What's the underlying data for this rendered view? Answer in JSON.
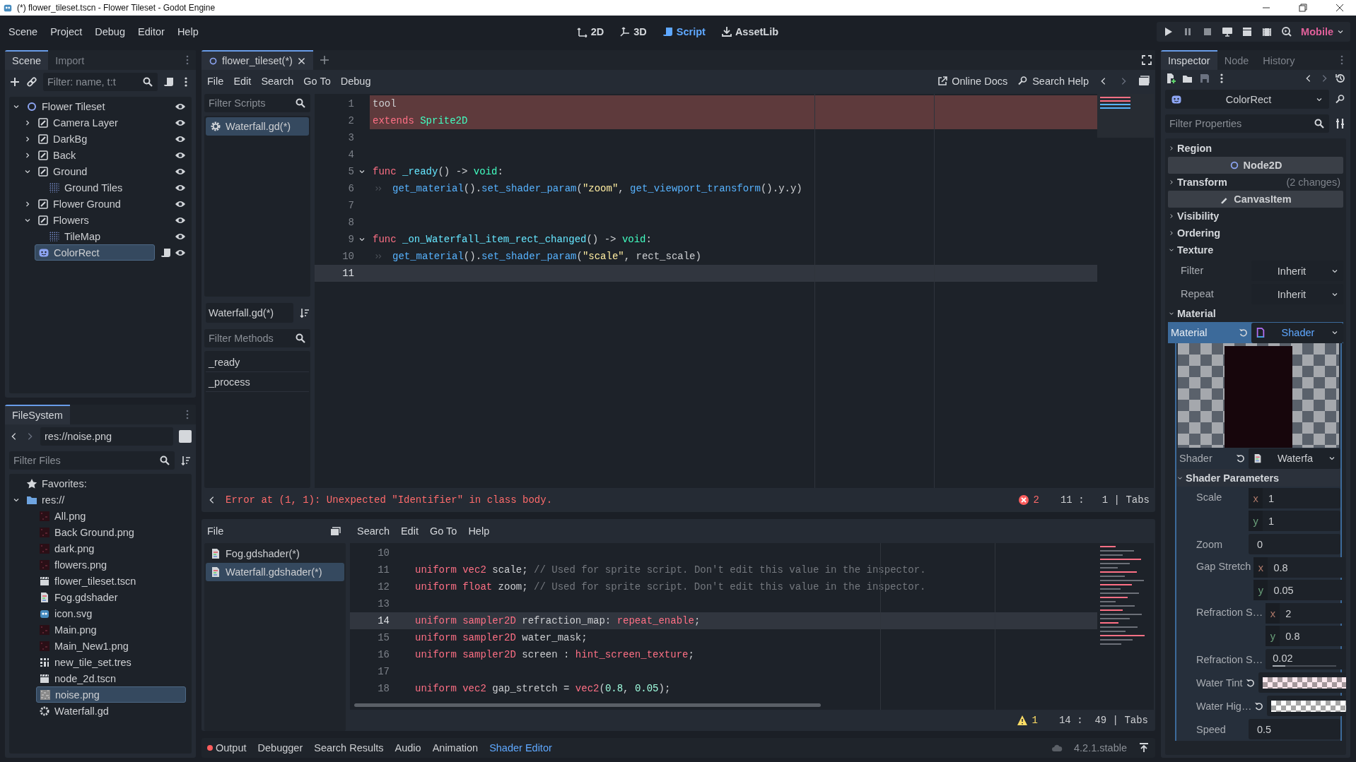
{
  "window": {
    "title": "(*) flower_tileset.tscn - Flower Tileset - Godot Engine"
  },
  "menu_bar": {
    "menus": [
      "Scene",
      "Project",
      "Debug",
      "Editor",
      "Help"
    ],
    "workspaces": [
      {
        "label": "2D",
        "selected": false
      },
      {
        "label": "3D",
        "selected": false
      },
      {
        "label": "Script",
        "selected": true
      },
      {
        "label": "AssetLib",
        "selected": false
      }
    ],
    "renderer": "Mobile"
  },
  "scene_dock": {
    "tabs": [
      {
        "label": "Scene",
        "selected": true
      },
      {
        "label": "Import",
        "selected": false
      }
    ],
    "filter": {
      "placeholder": "Filter: name, t:t"
    },
    "tree": [
      {
        "label": "Flower Tileset",
        "kind": "node2d",
        "expanded": true,
        "selected": false,
        "script": false,
        "visible": true,
        "children": [
          {
            "label": "Camera Layer",
            "kind": "layer",
            "expanded": false,
            "selected": false,
            "script": false,
            "visible": true
          },
          {
            "label": "DarkBg",
            "kind": "layer",
            "expanded": false,
            "selected": false,
            "script": false,
            "visible": true
          },
          {
            "label": "Back",
            "kind": "layer",
            "expanded": false,
            "selected": false,
            "script": false,
            "visible": true
          },
          {
            "label": "Ground",
            "kind": "layer",
            "expanded": true,
            "selected": false,
            "script": false,
            "visible": true,
            "children": [
              {
                "label": "Ground Tiles",
                "kind": "tilemap",
                "selected": false,
                "script": false,
                "visible": true
              }
            ]
          },
          {
            "label": "Flower Ground",
            "kind": "layer",
            "expanded": false,
            "selected": false,
            "script": false,
            "visible": true
          },
          {
            "label": "Flowers",
            "kind": "layer",
            "expanded": true,
            "selected": false,
            "script": false,
            "visible": true,
            "children": [
              {
                "label": "TileMap",
                "kind": "tilemap",
                "selected": false,
                "script": false,
                "visible": true
              }
            ]
          },
          {
            "label": "ColorRect",
            "kind": "control",
            "selected": true,
            "script": true,
            "visible": true
          }
        ]
      }
    ]
  },
  "filesystem_dock": {
    "tabs": [
      {
        "label": "FileSystem",
        "selected": true
      }
    ],
    "path": "res://noise.png",
    "filter": {
      "placeholder": "Filter Files"
    },
    "tree": [
      {
        "label": "Favorites:",
        "kind": "favorites",
        "selected": false
      },
      {
        "label": "res://",
        "kind": "folder",
        "expanded": true,
        "selected": false,
        "children": [
          {
            "label": "All.png",
            "kind": "image",
            "selected": false
          },
          {
            "label": "Back Ground.png",
            "kind": "image",
            "selected": false
          },
          {
            "label": "dark.png",
            "kind": "image",
            "selected": false
          },
          {
            "label": "flowers.png",
            "kind": "image",
            "selected": false
          },
          {
            "label": "flower_tileset.tscn",
            "kind": "scene",
            "selected": false
          },
          {
            "label": "Fog.gdshader",
            "kind": "shader",
            "selected": false
          },
          {
            "label": "icon.svg",
            "kind": "svg",
            "selected": false
          },
          {
            "label": "Main.png",
            "kind": "image",
            "selected": false
          },
          {
            "label": "Main_New1.png",
            "kind": "image",
            "selected": false
          },
          {
            "label": "new_tile_set.tres",
            "kind": "tileset",
            "selected": false
          },
          {
            "label": "node_2d.tscn",
            "kind": "scene",
            "selected": false
          },
          {
            "label": "noise.png",
            "kind": "noise",
            "selected": true
          },
          {
            "label": "Waterfall.gd",
            "kind": "script",
            "selected": false
          }
        ]
      }
    ]
  },
  "script_editor": {
    "tabs": [
      {
        "label": "flower_tileset(*)",
        "selected": true
      }
    ],
    "menus": [
      "File",
      "Edit",
      "Search",
      "Go To",
      "Debug"
    ],
    "help_links": [
      "Online Docs",
      "Search Help"
    ],
    "script_filter": {
      "placeholder": "Filter Scripts"
    },
    "scripts": [
      {
        "label": "Waterfall.gd(*)",
        "selected": true
      }
    ],
    "current_script": "Waterfall.gd(*)",
    "method_filter": {
      "placeholder": "Filter Methods"
    },
    "methods": [
      "_ready",
      "_process"
    ],
    "code_lines": [
      {
        "number": "1",
        "error": true,
        "current": false,
        "tokens": [
          {
            "kind": "text",
            "text": "tool"
          }
        ]
      },
      {
        "number": "2",
        "error": true,
        "current": false,
        "tokens": [
          {
            "kind": "keyword",
            "text": "extends"
          },
          {
            "kind": "type",
            "text": " Sprite2D"
          }
        ]
      },
      {
        "number": "3",
        "error": false,
        "current": false
      },
      {
        "number": "4",
        "error": false,
        "current": false
      },
      {
        "number": "5",
        "error": false,
        "current": false,
        "folded": false,
        "tokens": [
          {
            "kind": "keyword",
            "text": "func"
          },
          {
            "kind": "def",
            "text": " _ready"
          },
          {
            "kind": "text",
            "text": "() -> "
          },
          {
            "kind": "type",
            "text": "void"
          },
          {
            "kind": "text",
            "text": ":"
          }
        ]
      },
      {
        "number": "6",
        "error": false,
        "current": false,
        "indented": true,
        "tokens": [
          {
            "kind": "call",
            "text": "get_material"
          },
          {
            "kind": "text",
            "text": "()."
          },
          {
            "kind": "call",
            "text": "set_shader_param"
          },
          {
            "kind": "text",
            "text": "("
          },
          {
            "kind": "string",
            "text": "\"zoom\""
          },
          {
            "kind": "text",
            "text": ", "
          },
          {
            "kind": "call",
            "text": "get_viewport_transform"
          },
          {
            "kind": "text",
            "text": "().y.y)"
          }
        ]
      },
      {
        "number": "7",
        "error": false,
        "current": false
      },
      {
        "number": "8",
        "error": false,
        "current": false
      },
      {
        "number": "9",
        "error": false,
        "current": false,
        "folded": false,
        "tokens": [
          {
            "kind": "keyword",
            "text": "func"
          },
          {
            "kind": "def",
            "text": " _on_Waterfall_item_rect_changed"
          },
          {
            "kind": "text",
            "text": "() -> "
          },
          {
            "kind": "type",
            "text": "void"
          },
          {
            "kind": "text",
            "text": ":"
          }
        ]
      },
      {
        "number": "10",
        "error": false,
        "current": false,
        "indented": true,
        "tokens": [
          {
            "kind": "call",
            "text": "get_material"
          },
          {
            "kind": "text",
            "text": "()."
          },
          {
            "kind": "call",
            "text": "set_shader_param"
          },
          {
            "kind": "text",
            "text": "("
          },
          {
            "kind": "string",
            "text": "\"scale\""
          },
          {
            "kind": "text",
            "text": ", rect_scale)"
          }
        ]
      },
      {
        "number": "11",
        "error": false,
        "current": true
      }
    ],
    "error": "Error at (1, 1): Unexpected \"Identifier\" in class body.",
    "error_count": "2",
    "status": "11 :   1 | Tabs"
  },
  "shader_editor": {
    "file_menu": "File",
    "menus": [
      "Search",
      "Edit",
      "Go To",
      "Help"
    ],
    "files": [
      {
        "label": "Fog.gdshader(*)",
        "selected": false
      },
      {
        "label": "Waterfall.gdshader(*)",
        "selected": true
      }
    ],
    "code_lines": [
      {
        "number": "10",
        "current": false
      },
      {
        "number": "11",
        "current": false,
        "tokens": [
          {
            "kind": "keyword",
            "text": "uniform vec2"
          },
          {
            "kind": "text",
            "text": " scale; "
          },
          {
            "kind": "comment",
            "text": "// Used for sprite script. Don't edit this value in the inspector."
          }
        ]
      },
      {
        "number": "12",
        "current": false,
        "tokens": [
          {
            "kind": "keyword",
            "text": "uniform float"
          },
          {
            "kind": "text",
            "text": " zoom; "
          },
          {
            "kind": "comment",
            "text": "// Used for sprite script. Don't edit this value in the inspector."
          }
        ]
      },
      {
        "number": "13",
        "current": false
      },
      {
        "number": "14",
        "current": true,
        "tokens": [
          {
            "kind": "keyword",
            "text": "uniform sampler2D"
          },
          {
            "kind": "text",
            "text": " refraction_map: "
          },
          {
            "kind": "keyword",
            "text": "repeat_enable"
          },
          {
            "kind": "text",
            "text": ";"
          }
        ]
      },
      {
        "number": "15",
        "current": false,
        "tokens": [
          {
            "kind": "keyword",
            "text": "uniform sampler2D"
          },
          {
            "kind": "text",
            "text": " water_mask;"
          }
        ]
      },
      {
        "number": "16",
        "current": false,
        "tokens": [
          {
            "kind": "keyword",
            "text": "uniform sampler2D"
          },
          {
            "kind": "text",
            "text": " screen : "
          },
          {
            "kind": "keyword",
            "text": "hint_screen_texture"
          },
          {
            "kind": "text",
            "text": ";"
          }
        ]
      },
      {
        "number": "17",
        "current": false
      },
      {
        "number": "18",
        "current": false,
        "tokens": [
          {
            "kind": "keyword",
            "text": "uniform vec2"
          },
          {
            "kind": "text",
            "text": " gap_stretch = "
          },
          {
            "kind": "keyword",
            "text": "vec2"
          },
          {
            "kind": "text",
            "text": "("
          },
          {
            "kind": "number",
            "text": "0.8"
          },
          {
            "kind": "text",
            "text": ", "
          },
          {
            "kind": "number",
            "text": "0.05"
          },
          {
            "kind": "text",
            "text": ");"
          }
        ]
      }
    ],
    "warning_count": "1",
    "status": "14 :  49 | Tabs"
  },
  "bottom_panel": {
    "tabs": [
      {
        "label": "Output",
        "selected": false,
        "alert": true
      },
      {
        "label": "Debugger",
        "selected": false,
        "alert": false
      },
      {
        "label": "Search Results",
        "selected": false,
        "alert": false
      },
      {
        "label": "Audio",
        "selected": false,
        "alert": false
      },
      {
        "label": "Animation",
        "selected": false,
        "alert": false
      },
      {
        "label": "Shader Editor",
        "selected": true,
        "alert": false
      }
    ],
    "version": "4.2.1.stable"
  },
  "inspector": {
    "tabs": [
      {
        "label": "Inspector",
        "selected": true
      },
      {
        "label": "Node",
        "selected": false
      },
      {
        "label": "History",
        "selected": false
      }
    ],
    "object": "ColorRect",
    "filter": {
      "placeholder": "Filter Properties"
    },
    "properties": [
      {
        "kind": "group",
        "label": "Region",
        "expanded": false
      },
      {
        "kind": "category",
        "label": "Node2D"
      },
      {
        "kind": "group",
        "label": "Transform",
        "expanded": false,
        "note": "(2 changes)"
      },
      {
        "kind": "category",
        "label": "CanvasItem"
      },
      {
        "kind": "group",
        "label": "Visibility",
        "expanded": false
      },
      {
        "kind": "group",
        "label": "Ordering",
        "expanded": false
      },
      {
        "kind": "group",
        "label": "Texture",
        "expanded": true
      },
      {
        "kind": "enum",
        "label": "Filter",
        "value": "Inherit"
      },
      {
        "kind": "enum",
        "label": "Repeat",
        "value": "Inherit"
      },
      {
        "kind": "group",
        "label": "Material",
        "expanded": true
      },
      {
        "kind": "resource",
        "label": "Material",
        "value": "Shader",
        "expanded": true,
        "modified": true
      },
      {
        "kind": "preview"
      },
      {
        "kind": "resource",
        "label": "Shader",
        "value": "Waterfa",
        "expanded": false,
        "modified": true
      },
      {
        "kind": "subgroup",
        "label": "Shader Parameters",
        "expanded": true
      },
      {
        "kind": "vector",
        "label": "Scale",
        "components": [
          {
            "axis": "x",
            "value": "1"
          },
          {
            "axis": "y",
            "value": "1"
          }
        ]
      },
      {
        "kind": "number",
        "label": "Zoom",
        "value": "0"
      },
      {
        "kind": "vector",
        "label": "Gap Stretch",
        "components": [
          {
            "axis": "x",
            "value": "0.8"
          },
          {
            "axis": "y",
            "value": "0.05"
          }
        ]
      },
      {
        "kind": "vector",
        "label": "Refraction S…",
        "components": [
          {
            "axis": "x",
            "value": "2"
          },
          {
            "axis": "y",
            "value": "0.8"
          }
        ]
      },
      {
        "kind": "slider",
        "label": "Refraction S…",
        "value": "0.02",
        "level": 0.2
      },
      {
        "kind": "color",
        "label": "Water Tint",
        "color": "#fce9ef",
        "modified": true
      },
      {
        "kind": "color",
        "label": "Water Hig…",
        "color": "#ffffff",
        "modified": true
      },
      {
        "kind": "number",
        "label": "Speed",
        "value": "0.5"
      }
    ]
  }
}
